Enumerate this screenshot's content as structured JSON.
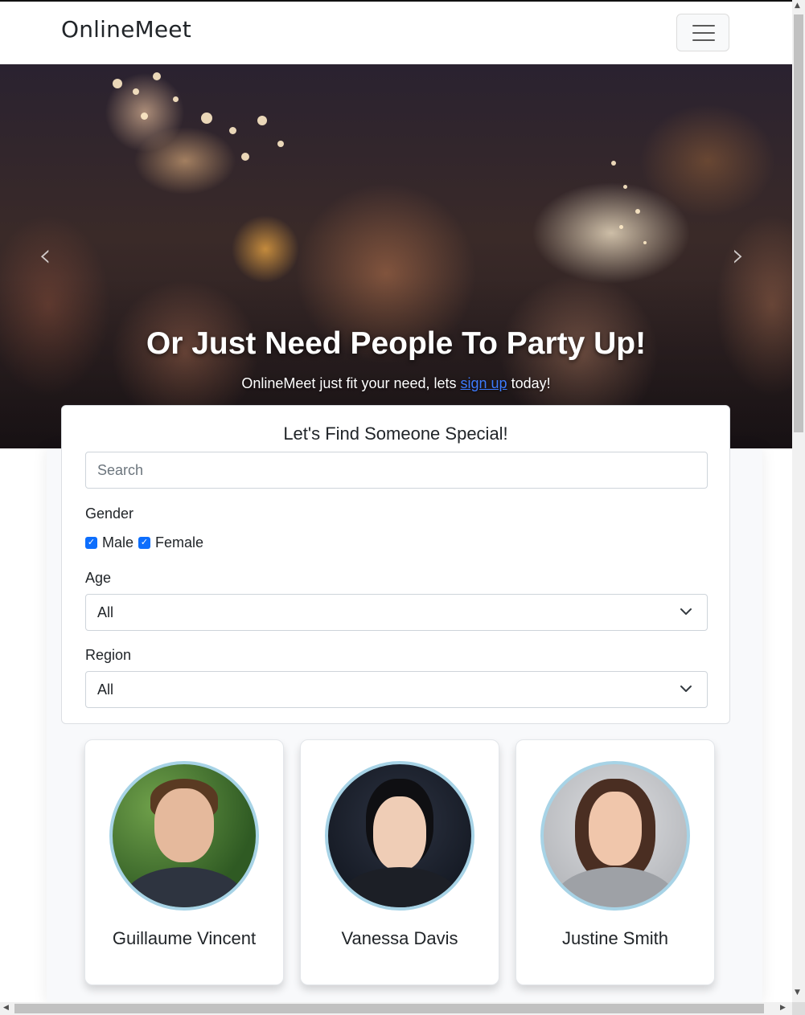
{
  "navbar": {
    "brand": "OnlineMeet",
    "toggler_icon": "hamburger-icon"
  },
  "hero": {
    "title": "Or Just Need People To Party Up!",
    "subtitle_before": "OnlineMeet just fit your need, lets ",
    "subtitle_link": "sign up",
    "subtitle_after": " today!",
    "prev_icon": "chevron-left-icon",
    "next_icon": "chevron-right-icon",
    "prev_glyph": "‹",
    "next_glyph": "›"
  },
  "search": {
    "title": "Let's Find Someone Special!",
    "placeholder": "Search",
    "gender_label": "Gender",
    "gender_options": [
      {
        "label": "Male",
        "checked": true
      },
      {
        "label": "Female",
        "checked": true
      }
    ],
    "age_label": "Age",
    "age_value": "All",
    "region_label": "Region",
    "region_value": "All"
  },
  "profiles": [
    {
      "name": "Guillaume Vincent"
    },
    {
      "name": "Vanessa Davis"
    },
    {
      "name": "Justine Smith"
    }
  ],
  "colors": {
    "accent": "#0d6efd",
    "avatar_border": "#a7d3e6",
    "link": "#3d7bfd"
  }
}
